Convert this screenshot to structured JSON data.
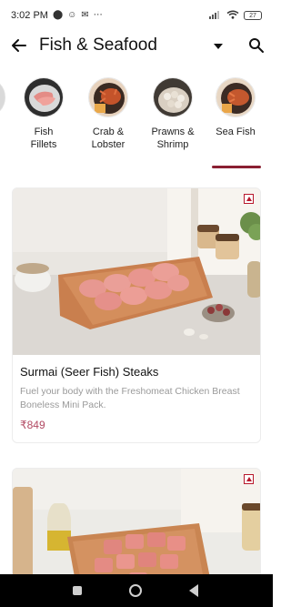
{
  "status_bar": {
    "time": "3:02 PM",
    "left_icons": [
      "location-icon",
      "smiley-icon",
      "mail-icon",
      "more-icon"
    ],
    "battery": "27"
  },
  "header": {
    "title": "Fish & Seafood",
    "back_icon": "arrow-left-icon",
    "dropdown_icon": "chevron-down-icon",
    "search_icon": "search-icon"
  },
  "categories": [
    {
      "label": "Fish\nFillets"
    },
    {
      "label": "Crab &\nLobster"
    },
    {
      "label": "Prawns &\nShrimp"
    },
    {
      "label": "Sea Fish"
    }
  ],
  "selected_category": "Sea Fish",
  "products": [
    {
      "name": "Surmai (Seer Fish) Steaks",
      "description": "Fuel your body with the Freshomeat Chicken Breast Boneless Mini Pack.",
      "price": "₹849"
    },
    {
      "name": "",
      "description": "",
      "price": ""
    }
  ],
  "colors": {
    "accent": "#8a1f32",
    "price": "#b24a63",
    "badge": "#b8182c"
  }
}
